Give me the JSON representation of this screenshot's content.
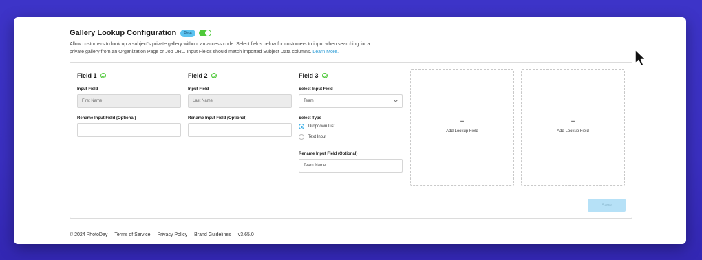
{
  "header": {
    "title": "Gallery Lookup Configuration",
    "badge": "Beta",
    "toggle_on": true,
    "description": "Allow customers to look up a subject's private gallery without an access code. Select fields below for customers to input when searching for a private gallery from an Organization Page or Job URL. Input Fields should match imported Subject Data columns.",
    "learn_more": "Learn More."
  },
  "fields": [
    {
      "name": "Field 1",
      "input_label": "Input Field",
      "input_value": "First Name",
      "rename_label": "Rename Input Field (Optional)",
      "rename_value": ""
    },
    {
      "name": "Field 2",
      "input_label": "Input Field",
      "input_value": "Last Name",
      "rename_label": "Rename Input Field (Optional)",
      "rename_value": ""
    },
    {
      "name": "Field 3",
      "input_label": "Select Input Field",
      "input_value": "Team",
      "type_label": "Select Type",
      "type_options": [
        "Dropdown List",
        "Text Input"
      ],
      "type_selected": "Dropdown List",
      "rename_label": "Rename Input Field (Optional)",
      "rename_value": "Team Name"
    }
  ],
  "add_cards": [
    {
      "plus": "+",
      "label": "Add Lookup Field"
    },
    {
      "plus": "+",
      "label": "Add Lookup Field"
    }
  ],
  "save_label": "Save",
  "footer": {
    "copyright": "© 2024 PhotoDay",
    "links": [
      "Terms of Service",
      "Privacy Policy",
      "Brand Guidelines"
    ],
    "version": "v3.65.0"
  },
  "colors": {
    "background": "#3a2fc0",
    "accent": "#5cc3f0",
    "success": "#4fc93a",
    "link": "#2a9bd6"
  },
  "icons": [
    "check-circle-icon",
    "chevron-down-icon",
    "plus-icon",
    "cursor-icon"
  ]
}
